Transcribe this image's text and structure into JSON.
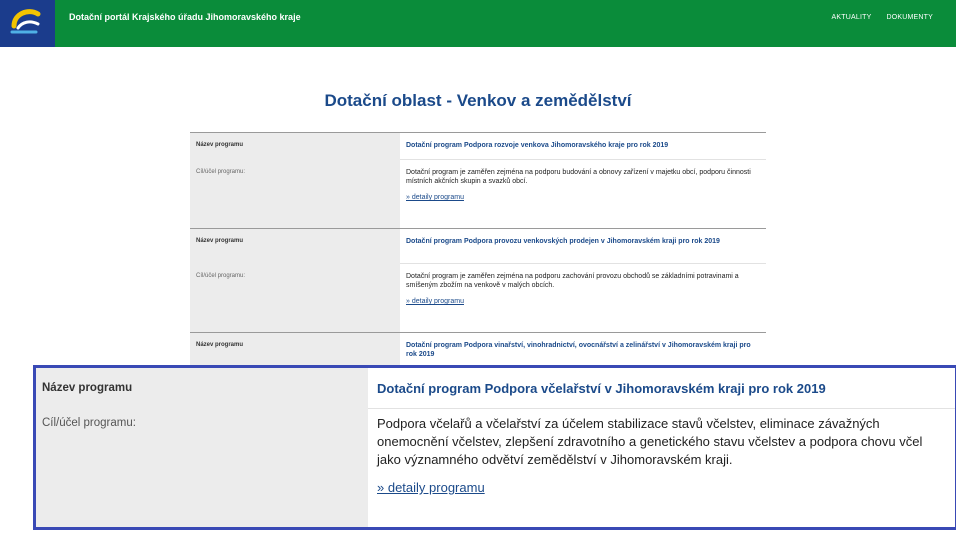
{
  "header": {
    "site_title": "Dotační portál Krajského úřadu Jihomoravského kraje",
    "nav": [
      "AKTUALITY",
      "DOKUMENTY"
    ],
    "colors": {
      "bar": "#0a8c3a",
      "logo_bg": "#1b3c8c"
    }
  },
  "page_title": "Dotační oblast - Venkov a zemědělství",
  "programs": [
    {
      "name_label": "Název programu",
      "name": "Dotační program Podpora rozvoje venkova Jihomoravského kraje pro rok 2019",
      "goal_label": "Cíl/účel programu:",
      "goal": "Dotační program je zaměřen zejména na podporu budování a obnovy zařízení v majetku obcí, podporu činnosti místních akčních skupin a svazků obcí.",
      "link": "» detaily programu"
    },
    {
      "name_label": "Název programu",
      "name": "Dotační program Podpora provozu venkovských prodejen v Jihomoravském kraji pro rok 2019",
      "goal_label": "Cíl/účel programu:",
      "goal": "Dotační program je zaměřen zejména na podporu zachování provozu obchodů se základními potravinami a smíšeným zbožím na venkově v malých obcích.",
      "link": "» detaily programu"
    },
    {
      "name_label": "Název programu",
      "name": "Dotační program Podpora vinařství, vinohradnictví, ovocnářství a zelinářství v Jihomoravském kraji pro rok 2019"
    }
  ],
  "zoom": {
    "name_label": "Název programu",
    "name": "Dotační program Podpora včelařství v Jihomoravském kraji pro rok 2019",
    "goal_label": "Cíl/účel programu:",
    "goal": "Podpora včelařů a včelařství za účelem stabilizace stavů včelstev, eliminace závažných onemocnění včelstev, zlepšení zdravotního a genetického stavu včelstev a podpora chovu včel jako významného odvětví zemědělství v Jihomoravském kraji.",
    "link": "» detaily programu",
    "highlight_color": "#3949b5"
  }
}
